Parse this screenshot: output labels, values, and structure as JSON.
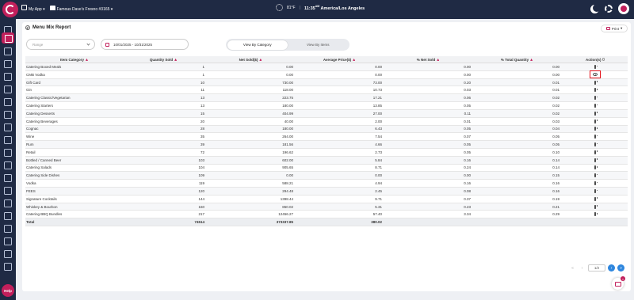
{
  "topbar": {
    "app_switch": "My App",
    "store": "Famous Dave's Fresno #3165",
    "weather": "81°F",
    "time": "11:35",
    "time_suffix": "AM",
    "timezone": "America/Los Angeles"
  },
  "help_label": "Help",
  "report": {
    "title": "Menu Mix Report",
    "print_label": "Print",
    "range_placeholder": "Range",
    "date_range": "10/01/2025 - 10/31/2025",
    "view_tabs": [
      "View By Category",
      "View By Items"
    ],
    "active_tab": "View By Category"
  },
  "table": {
    "headers": [
      "Item Category",
      "Quantity Sold",
      "Net Sold($)",
      "Average Price($)",
      "% Net Sold",
      "% Total Quantity",
      "Action(s)"
    ],
    "rows": [
      [
        "Catering Boxed Meals",
        "1",
        "0.00",
        "0.00",
        "0.00",
        "0.00"
      ],
      [
        "CMB Vodka",
        "1",
        "0.00",
        "0.00",
        "0.00",
        "0.00"
      ],
      [
        "Gift Card",
        "10",
        "730.00",
        "73.00",
        "0.20",
        "0.01"
      ],
      [
        "Gin",
        "11",
        "118.00",
        "10.73",
        "0.03",
        "0.01"
      ],
      [
        "Catering Classic/Vegetarian",
        "13",
        "223.75",
        "17.21",
        "0.06",
        "0.02"
      ],
      [
        "Catering Starters",
        "13",
        "180.00",
        "13.85",
        "0.05",
        "0.02"
      ],
      [
        "Catering Desserts",
        "15",
        "404.99",
        "27.00",
        "0.11",
        "0.02"
      ],
      [
        "Catering Beverages",
        "20",
        "40.00",
        "2.00",
        "0.01",
        "0.03"
      ],
      [
        "Cognac",
        "28",
        "180.00",
        "6.43",
        "0.05",
        "0.04"
      ],
      [
        "Wine",
        "35",
        "264.00",
        "7.54",
        "0.07",
        "0.05"
      ],
      [
        "Rum",
        "39",
        "181.56",
        "4.66",
        "0.05",
        "0.05"
      ],
      [
        "Retail",
        "72",
        "196.62",
        "2.73",
        "0.05",
        "0.10"
      ],
      [
        "Bottled / Canned Beer",
        "103",
        "602.00",
        "5.84",
        "0.16",
        "0.14"
      ],
      [
        "Catering Salads",
        "104",
        "905.65",
        "8.71",
        "0.24",
        "0.14"
      ],
      [
        "Catering Side Dishes",
        "109",
        "0.00",
        "0.00",
        "0.00",
        "0.15"
      ],
      [
        "Vodka",
        "119",
        "588.21",
        "4.94",
        "0.16",
        "0.16"
      ],
      [
        "FEES",
        "120",
        "294.48",
        "2.45",
        "0.08",
        "0.16"
      ],
      [
        "Signature Cocktails",
        "144",
        "1398.44",
        "9.71",
        "0.37",
        "0.19"
      ],
      [
        "Whiskey & Bourbon",
        "160",
        "850.02",
        "5.31",
        "0.23",
        "0.21"
      ],
      [
        "Catering BBQ Bundles",
        "217",
        "12456.27",
        "57.40",
        "3.34",
        "0.29"
      ]
    ],
    "total": [
      "Total",
      "74514",
      "373337.85",
      "380.02",
      "",
      ""
    ],
    "highlighted_row": 1
  },
  "pager": {
    "page": "1/2",
    "first": "«",
    "prev": "‹",
    "next": "›",
    "last": "»"
  },
  "colors": {
    "brand": "#c21f5b",
    "nav": "#1f2a44",
    "highlight": "#e3121a",
    "pager_active": "#2e86de"
  },
  "icons": [
    "logo-icon",
    "moon-icon",
    "gear-icon",
    "avatar-icon",
    "eye-icon",
    "calendar-icon",
    "print-icon",
    "chat-icon"
  ]
}
